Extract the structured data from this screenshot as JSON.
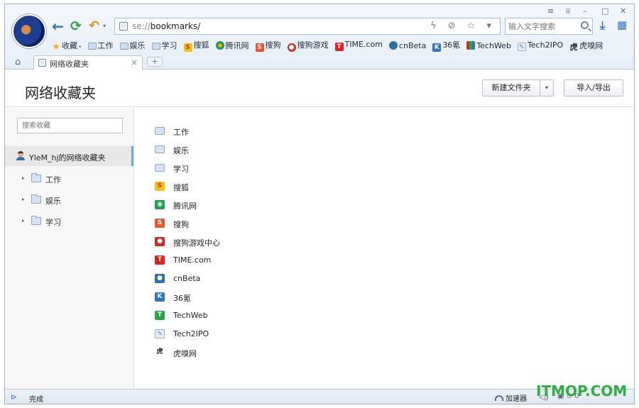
{
  "window_controls": {
    "menu": "≡",
    "skin": "♕",
    "minimize": "–",
    "maximize": "□",
    "close": "✕"
  },
  "nav": {
    "back": "←",
    "refresh": "⟳",
    "undo": "↶",
    "undo_dropdown": "▾"
  },
  "address": {
    "scheme": "se://",
    "path": "bookmarks/",
    "tools": "ϟ ⊘ ☆ ▾"
  },
  "search": {
    "placeholder": "输入文字搜索"
  },
  "toolbar_right": {
    "download": "⤓",
    "apps": "▦"
  },
  "bookmarks_bar": [
    {
      "label": "收藏",
      "icon": "star-icon",
      "glyph": "★",
      "dropdown": "▾"
    },
    {
      "label": "工作",
      "icon": "folder-icon",
      "glyph": ""
    },
    {
      "label": "娱乐",
      "icon": "folder-icon",
      "glyph": ""
    },
    {
      "label": "学习",
      "icon": "folder-icon",
      "glyph": ""
    },
    {
      "label": "搜狐",
      "icon": "sohu-icon",
      "glyph": "S"
    },
    {
      "label": "腾讯网",
      "icon": "qq-icon",
      "glyph": ""
    },
    {
      "label": "搜狗",
      "icon": "sogou-icon",
      "glyph": "S"
    },
    {
      "label": "搜狗游戏",
      "icon": "sogou-game-icon",
      "glyph": "●"
    },
    {
      "label": "TIME.com",
      "icon": "time-icon",
      "glyph": "T"
    },
    {
      "label": "cnBeta",
      "icon": "cnbeta-icon",
      "glyph": ""
    },
    {
      "label": "36氪",
      "icon": "36kr-icon",
      "glyph": "K"
    },
    {
      "label": "TechWeb",
      "icon": "techweb-icon",
      "glyph": ""
    },
    {
      "label": "Tech2IPO",
      "icon": "tech2ipo-icon",
      "glyph": "✎"
    },
    {
      "label": "虎嗅网",
      "icon": "huxiu-icon",
      "glyph": "虎"
    }
  ],
  "tabs": {
    "home": "⌂",
    "active_label": "网络收藏夹",
    "active_icon": "☆",
    "close": "×",
    "new_tab": "+"
  },
  "page": {
    "title": "网络收藏夹",
    "new_folder_label": "新建文件夹",
    "new_folder_dropdown": "▾",
    "import_export_label": "导入/导出"
  },
  "sidebar": {
    "search_placeholder": "搜索收藏",
    "root_label": "YleM_hj的网络收藏夹",
    "items": [
      {
        "label": "工作",
        "arrow": "▸"
      },
      {
        "label": "娱乐",
        "arrow": "▸"
      },
      {
        "label": "学习",
        "arrow": "▸"
      }
    ]
  },
  "main_list": [
    {
      "label": "工作",
      "icon": "folder-icon",
      "glyph": "",
      "color": "#d7e3f1"
    },
    {
      "label": "娱乐",
      "icon": "folder-icon",
      "glyph": "",
      "color": "#d7e3f1"
    },
    {
      "label": "学习",
      "icon": "folder-icon",
      "glyph": "",
      "color": "#d7e3f1"
    },
    {
      "label": "搜狐",
      "icon": "sohu-icon",
      "glyph": "S",
      "color": "#f1c40f"
    },
    {
      "label": "腾讯网",
      "icon": "qq-icon",
      "glyph": "◉",
      "color": "#1aa34a"
    },
    {
      "label": "搜狗",
      "icon": "sogou-icon",
      "glyph": "S",
      "color": "#e8542c"
    },
    {
      "label": "搜狗游戏中心",
      "icon": "sogou-game-icon",
      "glyph": "●",
      "color": "#d7261f"
    },
    {
      "label": "TIME.com",
      "icon": "time-icon",
      "glyph": "T",
      "color": "#e02020"
    },
    {
      "label": "cnBeta",
      "icon": "cnbeta-icon",
      "glyph": "●",
      "color": "#2f6fa8"
    },
    {
      "label": "36氪",
      "icon": "36kr-icon",
      "glyph": "K",
      "color": "#2d74c8"
    },
    {
      "label": "TechWeb",
      "icon": "techweb-icon",
      "glyph": "T",
      "color": "#27a844"
    },
    {
      "label": "Tech2IPO",
      "icon": "tech2ipo-icon",
      "glyph": "✎",
      "color": "#e8eef5"
    },
    {
      "label": "虎嗅网",
      "icon": "huxiu-icon",
      "glyph": "虎",
      "color": "#ffffff"
    }
  ],
  "statusbar": {
    "toggle": "⊳",
    "status": "完成",
    "accelerate": "加速器",
    "sound": "◁)",
    "misc": "▣ ⊙ 0"
  },
  "watermark": "ITMOP.COM"
}
